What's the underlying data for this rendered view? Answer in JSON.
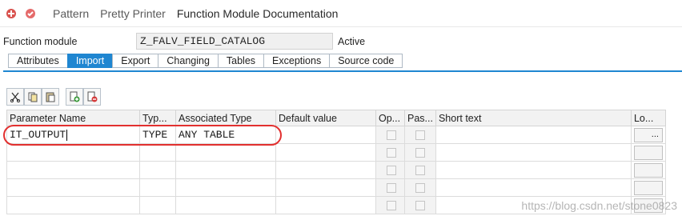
{
  "toolbar": {
    "pattern": "Pattern",
    "pretty_printer": "Pretty Printer",
    "documentation": "Function Module Documentation"
  },
  "function_module": {
    "label": "Function module",
    "value": "Z_FALV_FIELD_CATALOG",
    "status": "Active"
  },
  "tabs": [
    "Attributes",
    "Import",
    "Export",
    "Changing",
    "Tables",
    "Exceptions",
    "Source code"
  ],
  "active_tab": "Import",
  "grid": {
    "columns": [
      "Parameter Name",
      "Typ...",
      "Associated Type",
      "Default value",
      "Op...",
      "Pas...",
      "Short text",
      "Lo..."
    ],
    "rows": [
      {
        "name": "IT_OUTPUT",
        "typing": "TYPE",
        "assoc_type": "ANY TABLE",
        "default": "",
        "optional": false,
        "pass_value": false,
        "short_text": "",
        "long_text_button": "..."
      }
    ]
  },
  "watermark": "https://blog.csdn.net/stone0823",
  "colors": {
    "tab_active": "#1f86d1",
    "highlight": "#e2302f"
  }
}
